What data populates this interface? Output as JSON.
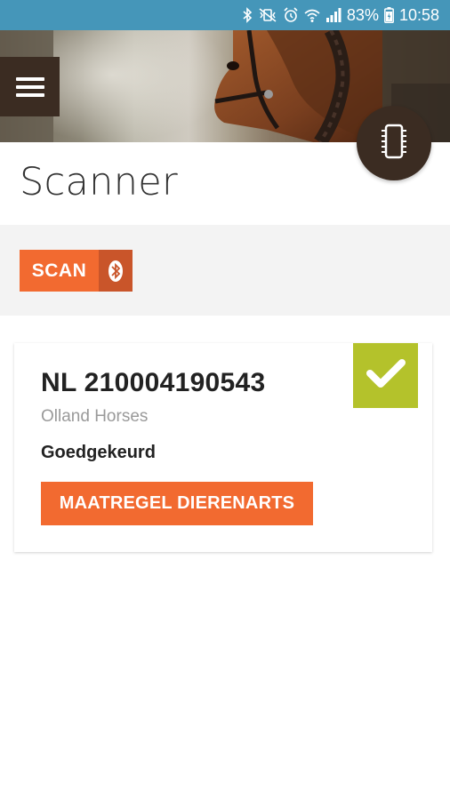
{
  "status_bar": {
    "battery": "83%",
    "time": "10:58",
    "icons": [
      "bluetooth-icon",
      "vibrate-mute-icon",
      "alarm-icon",
      "wifi-icon",
      "signal-icon",
      "battery-icon"
    ]
  },
  "header": {
    "menu_icon": "hamburger-menu-icon",
    "chip_icon": "microchip-icon"
  },
  "page": {
    "title": "Scanner"
  },
  "scan": {
    "label": "SCAN",
    "icon": "bluetooth-icon"
  },
  "result": {
    "id": "NL 210004190543",
    "owner": "Olland Horses",
    "status": "Goedgekeurd",
    "action_label": "MAATREGEL DIERENARTS",
    "check_icon": "check-icon"
  },
  "colors": {
    "status_bar": "#4596b9",
    "brand_dark": "#3b2c22",
    "accent_orange": "#f26a30",
    "accent_orange_dark": "#c9552a",
    "approved_green": "#b4c22b"
  }
}
